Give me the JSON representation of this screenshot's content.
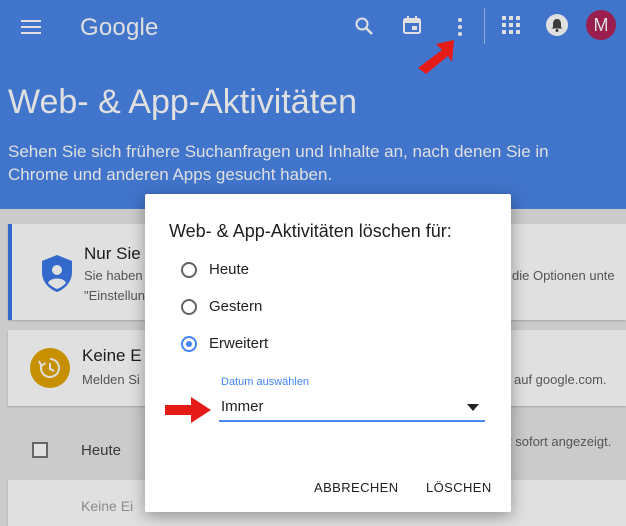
{
  "topbar": {
    "logo": "Google",
    "icons": [
      "menu-icon",
      "search-icon",
      "calendar-icon",
      "more-vert-icon",
      "apps-icon",
      "notifications-icon"
    ],
    "avatar_letter": "M"
  },
  "header": {
    "title": "Web- & App-Aktivitäten",
    "subtitle": "Sehen Sie sich frühere Suchanfragen und Inhalte an, nach denen Sie in Chrome und anderen Apps gesucht haben."
  },
  "cards": {
    "privacy": {
      "title": "Nur Sie",
      "line1": "Sie haben",
      "line1_right": "die Optionen unte",
      "line2": "\"Einstellun"
    },
    "activity": {
      "title": "Keine E",
      "line1": "Melden Si",
      "line1_right": "auf google.com."
    }
  },
  "list": {
    "today_label": "Heute",
    "today_right": "t sofort angezeigt.",
    "empty_text": "Keine Ei"
  },
  "dialog": {
    "title": "Web- & App-Aktivitäten löschen für:",
    "options": [
      {
        "label": "Heute",
        "selected": false
      },
      {
        "label": "Gestern",
        "selected": false
      },
      {
        "label": "Erweitert",
        "selected": true
      }
    ],
    "date_label": "Datum auswählen",
    "date_value": "Immer",
    "cancel_label": "ABBRECHEN",
    "delete_label": "LÖSCHEN"
  },
  "colors": {
    "header_bg": "#4a84e8",
    "accent": "#4285f4",
    "avatar_bg": "#b0245a",
    "history_icon_bg": "#e2a400",
    "annotation_arrow": "#e41b17"
  }
}
